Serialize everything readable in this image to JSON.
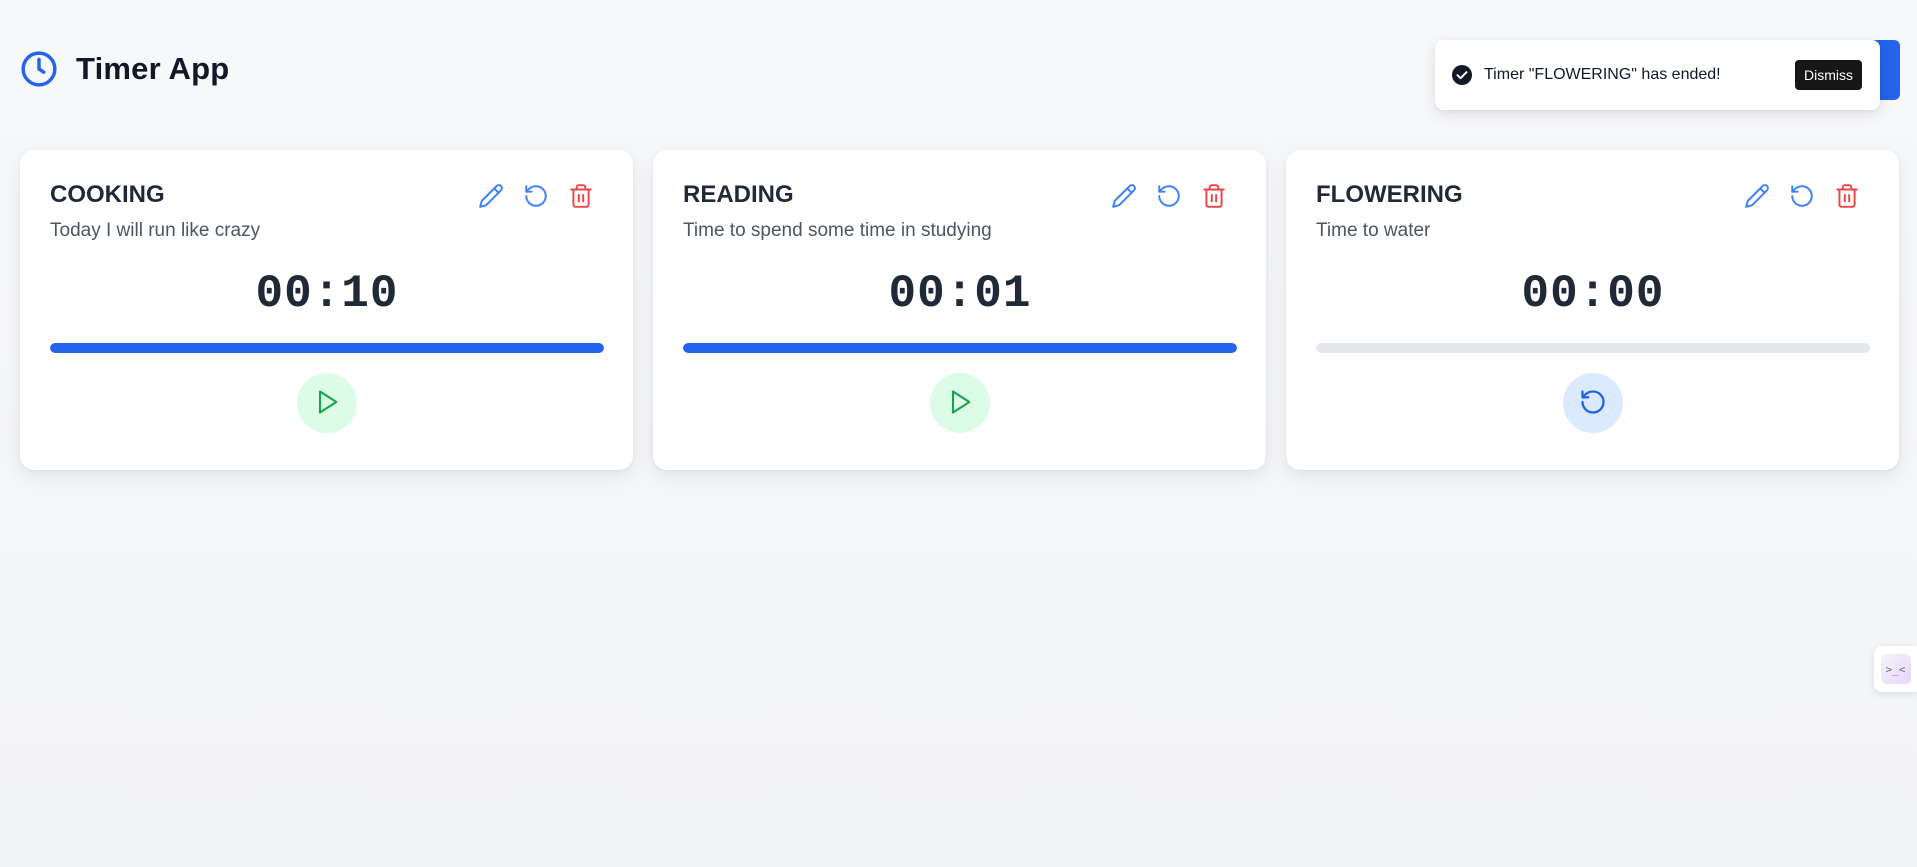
{
  "app": {
    "title": "Timer App",
    "logo_icon": "clock-icon",
    "accent_color": "#2563eb"
  },
  "toast": {
    "message": "Timer \"FLOWERING\" has ended!",
    "icon": "check-circle-icon",
    "dismiss_label": "Dismiss"
  },
  "timers": [
    {
      "title": "COOKING",
      "description": "Today I will run like crazy",
      "time": "00:10",
      "progress": 1.0,
      "control": "play",
      "control_icon": "play-icon"
    },
    {
      "title": "READING",
      "description": "Time to spend some time in studying",
      "time": "00:01",
      "progress": 1.0,
      "control": "play",
      "control_icon": "play-icon"
    },
    {
      "title": "FLOWERING",
      "description": "Time to water",
      "time": "00:00",
      "progress": 0.0,
      "control": "restart",
      "control_icon": "restart-icon"
    }
  ],
  "card_actions": [
    "pencil-icon",
    "reset-icon",
    "trash-icon"
  ],
  "colors": {
    "edit": "#3b82f6",
    "reset": "#3b82f6",
    "delete": "#ef4444",
    "play": "#16a34a",
    "play_bg": "#dcfce7",
    "restart": "#2563eb",
    "restart_bg": "#dbeafe"
  },
  "side_widget": {
    "label": ">_<"
  }
}
